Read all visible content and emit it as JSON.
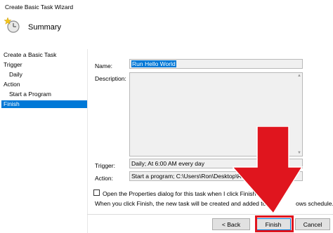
{
  "window": {
    "title": "Create Basic Task Wizard"
  },
  "header": {
    "title": "Summary"
  },
  "sidebar": {
    "items": [
      {
        "label": "Create a Basic Task"
      },
      {
        "label": "Trigger"
      },
      {
        "label": "Daily"
      },
      {
        "label": "Action"
      },
      {
        "label": "Start a Program"
      },
      {
        "label": "Finish",
        "selected": true
      }
    ]
  },
  "summary": {
    "name_label": "Name:",
    "name_value": "Run Hello World",
    "description_label": "Description:",
    "description_value": "",
    "trigger_label": "Trigger:",
    "trigger_value": "Daily; At 6:00 AM every day",
    "action_label": "Action:",
    "action_value": "Start a program; C:\\Users\\Ron\\Desktop\\Run_Py"
  },
  "options": {
    "open_properties_label": "Open the Properties dialog for this task when I click Finish",
    "open_properties_checked": false,
    "info_text_left": "When you click Finish, the new task will be created and added to y",
    "info_text_right": "ows schedule."
  },
  "buttons": {
    "back_label": "< Back",
    "finish_label": "Finish",
    "cancel_label": "Cancel"
  },
  "colors": {
    "selection": "#0078d7",
    "annotation": "#e0151e"
  },
  "icons": {
    "wizard": "clock-with-star-icon",
    "annotation": "red-down-arrow"
  }
}
